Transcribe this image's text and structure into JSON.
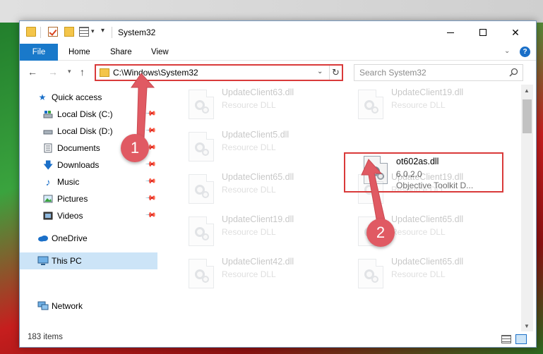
{
  "window": {
    "title": "System32",
    "controls": {
      "minimize": "minimize",
      "maximize": "maximize",
      "close": "✕"
    }
  },
  "ribbon": {
    "tabs": [
      "File",
      "Home",
      "Share",
      "View"
    ],
    "help": "?"
  },
  "navbar": {
    "address": "C:\\Windows\\System32",
    "search_placeholder": "Search System32",
    "refresh_glyph": "↻",
    "back_glyph": "←",
    "forward_glyph": "→",
    "up_glyph": "↑"
  },
  "sidebar": {
    "items": [
      {
        "label": "Quick access",
        "icon": "star-icon",
        "pinned": false
      },
      {
        "label": "Local Disk (C:)",
        "icon": "drive-icon",
        "pinned": true
      },
      {
        "label": "Local Disk (D:)",
        "icon": "drive-icon",
        "pinned": true
      },
      {
        "label": "Documents",
        "icon": "documents-icon",
        "pinned": true
      },
      {
        "label": "Downloads",
        "icon": "download-icon",
        "pinned": true
      },
      {
        "label": "Music",
        "icon": "music-icon",
        "pinned": true
      },
      {
        "label": "Pictures",
        "icon": "pictures-icon",
        "pinned": true
      },
      {
        "label": "Videos",
        "icon": "videos-icon",
        "pinned": true
      },
      {
        "label": "OneDrive",
        "icon": "cloud-icon",
        "pinned": false
      },
      {
        "label": "This PC",
        "icon": "pc-icon",
        "pinned": false,
        "selected": true
      },
      {
        "label": "Network",
        "icon": "network-icon",
        "pinned": false
      }
    ]
  },
  "files": [
    {
      "name": "UpdateClient63.dll",
      "line2": "Resource DLL",
      "line3": "",
      "ghost": true
    },
    {
      "name": "UpdateClient19.dll",
      "line2": "Resource DLL",
      "line3": "",
      "ghost": true
    },
    {
      "name": "UpdateClient5.dll",
      "line2": "Resource DLL",
      "line3": "",
      "ghost": true
    },
    {
      "name": "ot602as.dll",
      "line2": "6.0.2.0",
      "line3": "Objective Toolkit D...",
      "ghost": false
    },
    {
      "name": "UpdateClient65.dll",
      "line2": "Resource DLL",
      "line3": "",
      "ghost": true
    },
    {
      "name": "UpdateClient19.dll",
      "line2": "Resource DLL",
      "line3": "",
      "ghost": true
    },
    {
      "name": "UpdateClient19.dll",
      "line2": "Resource DLL",
      "line3": "",
      "ghost": true
    },
    {
      "name": "UpdateClient65.dll",
      "line2": "Resource DLL",
      "line3": "",
      "ghost": true
    },
    {
      "name": "UpdateClient42.dll",
      "line2": "Resource DLL",
      "line3": "",
      "ghost": true
    },
    {
      "name": "UpdateClient65.dll",
      "line2": "Resource DLL",
      "line3": "",
      "ghost": true
    }
  ],
  "status": {
    "item_count": "183 items"
  },
  "callouts": [
    "1",
    "2"
  ],
  "colors": {
    "accent": "#1979ca",
    "highlight": "#d93a3a",
    "callout": "#e05a63",
    "selected": "#cce4f7"
  }
}
